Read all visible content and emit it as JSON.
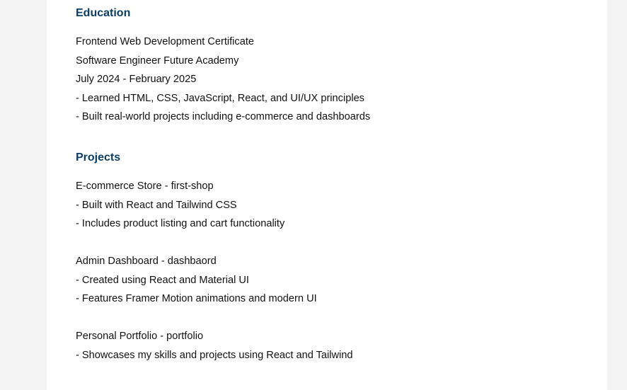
{
  "education": {
    "title": "Education",
    "lines": [
      "Frontend Web Development Certificate",
      "Software Engineer Future Academy",
      "July 2024 - February 2025",
      "- Learned HTML, CSS, JavaScript, React, and UI/UX principles",
      "- Built real-world projects including e-commerce and dashboards"
    ]
  },
  "projects": {
    "title": "Projects",
    "items": [
      {
        "heading": "E-commerce Store - first-shop",
        "bullets": [
          "- Built with React and Tailwind CSS",
          "- Includes product listing and cart functionality"
        ]
      },
      {
        "heading": "Admin Dashboard - dashbaord",
        "bullets": [
          "- Created using React and Material UI",
          "- Features Framer Motion animations and modern UI"
        ]
      },
      {
        "heading": "Personal Portfolio - portfolio",
        "bullets": [
          "- Showcases my skills and projects using React and Tailwind"
        ]
      }
    ]
  }
}
